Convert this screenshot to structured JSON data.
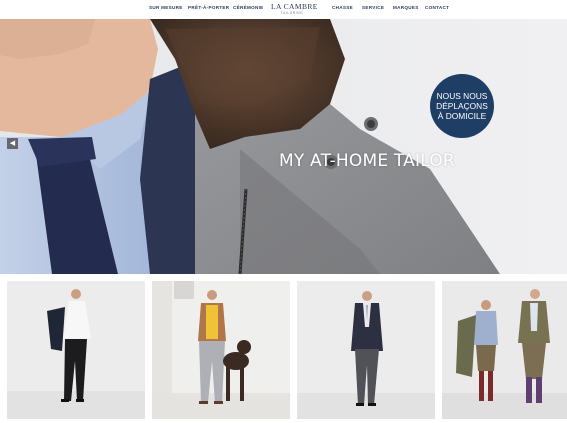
{
  "nav": {
    "left_items": [
      "SUR MESURE",
      "PRÊT-À-PORTER",
      "CÉRÉMONIE"
    ],
    "logo_name": "LA CAMBRE",
    "logo_subtitle": "TAILORING",
    "right_items": [
      "CHASSE",
      "SERVICE",
      "MARQUES",
      "CONTACT"
    ]
  },
  "hero": {
    "title": "MY AT-HOME TAILOR",
    "badge_lines": [
      "NOUS NOUS",
      "DÉPLAÇONS",
      "À DOMICILE"
    ],
    "arrow_icon": "chevron-left-icon"
  },
  "tiles": [
    "sur-mesure-photo",
    "pret-a-porter-photo",
    "ceremonie-photo",
    "chasse-photo"
  ],
  "colors": {
    "brand_navy": "#2a3b5c",
    "badge_blue": "#1e3e66",
    "coat_grey": "#8c8d90",
    "shirt_blue": "#aebfdc",
    "tie_navy": "#232b4f",
    "fur_brown": "#4a3528"
  }
}
